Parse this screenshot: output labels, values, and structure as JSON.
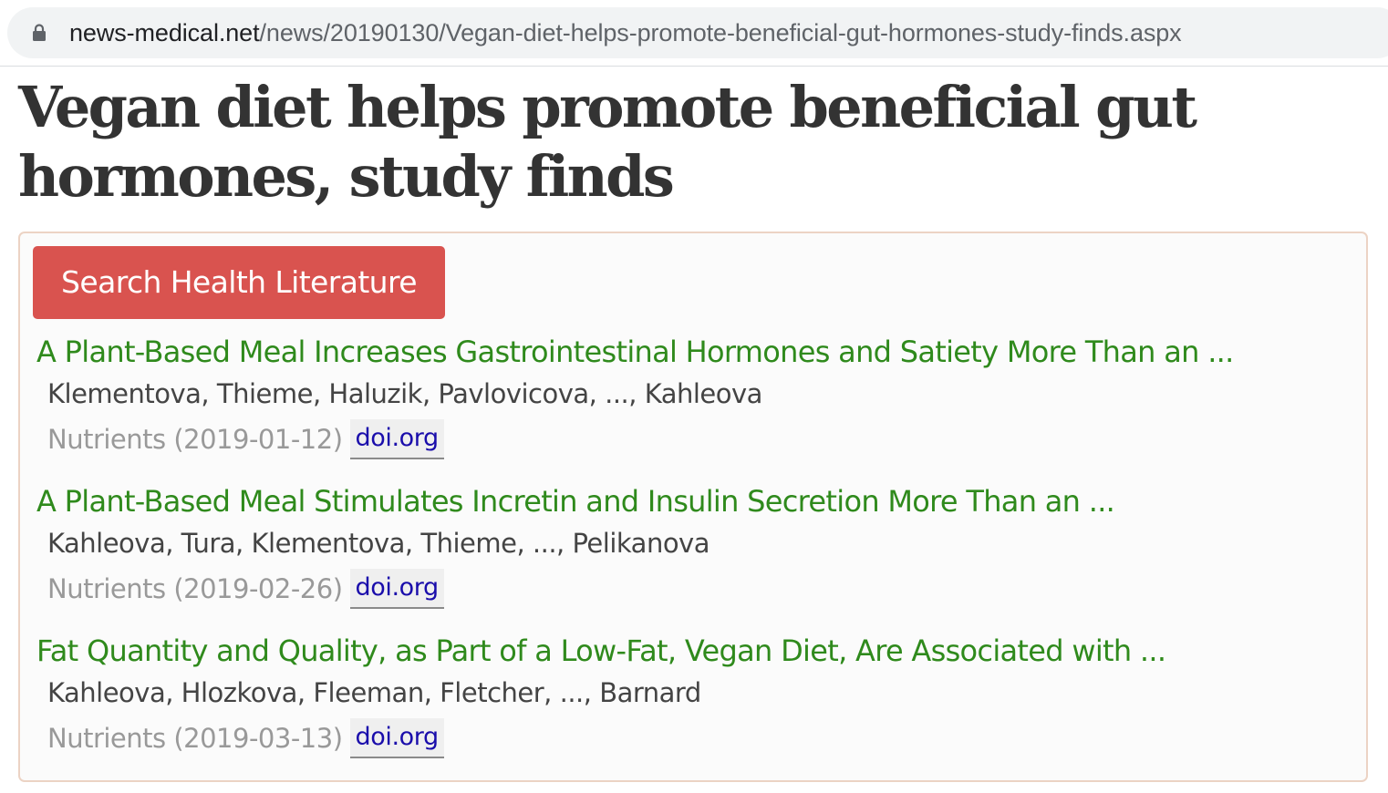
{
  "browser": {
    "url_host": "news-medical.net",
    "url_path": "/news/20190130/Vegan-diet-helps-promote-beneficial-gut-hormones-study-finds.aspx",
    "lock_icon": "lock-icon"
  },
  "article": {
    "headline": "Vegan diet helps promote beneficial gut hormones, study finds"
  },
  "literature": {
    "search_button_label": "Search Health Literature",
    "button_color": "#d9534f",
    "title_color": "#2f8a1c",
    "link_color": "#1a0dab",
    "results": [
      {
        "title": "A Plant-Based Meal Increases Gastrointestinal Hormones and Satiety More Than an ...",
        "authors": "Klementova, Thieme, Haluzik, Pavlovicova, ..., Kahleova",
        "journal_date": "Nutrients (2019-01-12)",
        "link_label": "doi.org"
      },
      {
        "title": "A Plant-Based Meal Stimulates Incretin and Insulin Secretion More Than an ...",
        "authors": "Kahleova, Tura, Klementova, Thieme, ..., Pelikanova",
        "journal_date": "Nutrients (2019-02-26)",
        "link_label": "doi.org"
      },
      {
        "title": "Fat Quantity and Quality, as Part of a Low-Fat, Vegan Diet, Are Associated with ...",
        "authors": "Kahleova, Hlozkova, Fleeman, Fletcher, ..., Barnard",
        "journal_date": "Nutrients (2019-03-13)",
        "link_label": "doi.org"
      }
    ]
  }
}
